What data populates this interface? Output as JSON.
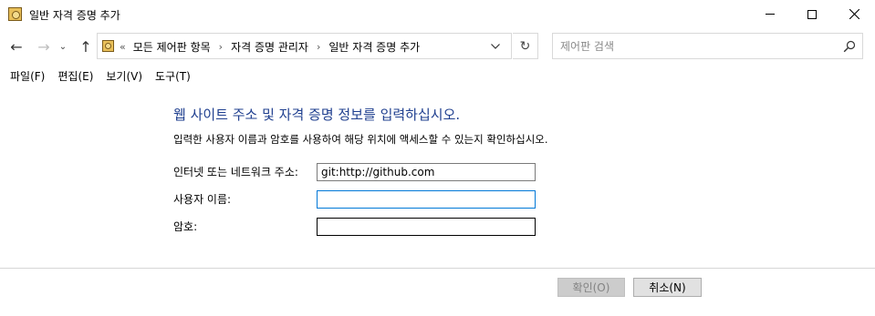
{
  "window": {
    "title": "일반 자격 증명 추가",
    "icon": "credential-manager-icon"
  },
  "nav": {
    "back": "←",
    "forward": "→",
    "recent": "⌄",
    "up": "↑",
    "breadcrumb_lead": "«",
    "breadcrumbs": [
      "모든 제어판 항목",
      "자격 증명 관리자",
      "일반 자격 증명 추가"
    ],
    "separator": "›",
    "refresh": "↻"
  },
  "search": {
    "placeholder": "제어판 검색",
    "value": ""
  },
  "menu": {
    "file": "파일(F)",
    "edit": "편집(E)",
    "view": "보기(V)",
    "tools": "도구(T)"
  },
  "form": {
    "heading": "웹 사이트 주소 및 자격 증명 정보를 입력하십시오.",
    "description": "입력한 사용자 이름과 암호를 사용하여 해당 위치에 액세스할 수 있는지 확인하십시오.",
    "address_label": "인터넷 또는 네트워크 주소:",
    "address_value": "git:http://github.com",
    "username_label": "사용자 이름:",
    "username_value": "",
    "password_label": "암호:",
    "password_value": ""
  },
  "buttons": {
    "ok": "확인(O)",
    "cancel": "취소(N)"
  },
  "colors": {
    "heading": "#1f3f8f",
    "focus_border": "#0078d7"
  }
}
